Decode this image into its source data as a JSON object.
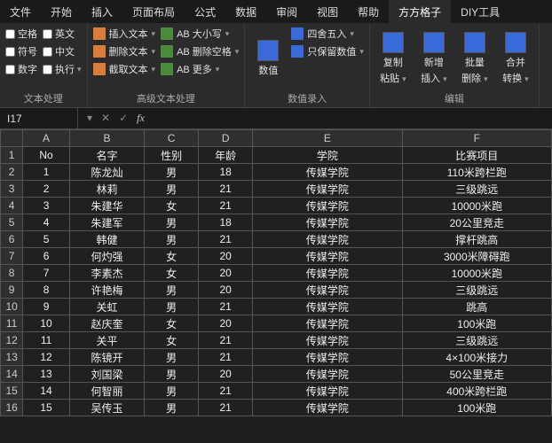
{
  "tabs": [
    "文件",
    "开始",
    "插入",
    "页面布局",
    "公式",
    "数据",
    "审阅",
    "视图",
    "帮助",
    "方方格子",
    "DIY工具"
  ],
  "active_tab": 9,
  "ribbon": {
    "text_proc": {
      "label": "文本处理",
      "checks": [
        "空格",
        "英文",
        "符号",
        "中文",
        "数字",
        "执行"
      ]
    },
    "adv_text": {
      "label": "高级文本处理",
      "col1": [
        "插入文本",
        "删除文本",
        "截取文本"
      ],
      "col2": [
        "大小写",
        "删除空格",
        "更多"
      ]
    },
    "data_entry": {
      "label": "数值录入",
      "big": "数值",
      "items": [
        "四舍五入",
        "只保留数值"
      ]
    },
    "edit": {
      "label": "编辑",
      "btns": [
        "复制粘贴",
        "新增插入",
        "批量删除",
        "合并转换"
      ]
    }
  },
  "namebox": "I17",
  "chart_data": {
    "type": "table",
    "columns": [
      "A",
      "B",
      "C",
      "D",
      "E",
      "F"
    ],
    "headers": [
      "No",
      "名字",
      "性别",
      "年龄",
      "学院",
      "比赛项目"
    ],
    "rows": [
      [
        "1",
        "陈龙灿",
        "男",
        "18",
        "传媒学院",
        "110米跨栏跑"
      ],
      [
        "2",
        "林莉",
        "男",
        "21",
        "传媒学院",
        "三级跳远"
      ],
      [
        "3",
        "朱建华",
        "女",
        "21",
        "传媒学院",
        "10000米跑"
      ],
      [
        "4",
        "朱建军",
        "男",
        "18",
        "传媒学院",
        "20公里竞走"
      ],
      [
        "5",
        "韩健",
        "男",
        "21",
        "传媒学院",
        "撑杆跳高"
      ],
      [
        "6",
        "何灼强",
        "女",
        "20",
        "传媒学院",
        "3000米障碍跑"
      ],
      [
        "7",
        "李素杰",
        "女",
        "20",
        "传媒学院",
        "10000米跑"
      ],
      [
        "8",
        "许艳梅",
        "男",
        "20",
        "传媒学院",
        "三级跳远"
      ],
      [
        "9",
        "关虹",
        "男",
        "21",
        "传媒学院",
        "跳高"
      ],
      [
        "10",
        "赵庆奎",
        "女",
        "20",
        "传媒学院",
        "100米跑"
      ],
      [
        "11",
        "关平",
        "女",
        "21",
        "传媒学院",
        "三级跳远"
      ],
      [
        "12",
        "陈镜开",
        "男",
        "21",
        "传媒学院",
        "4×100米接力"
      ],
      [
        "13",
        "刘国梁",
        "男",
        "20",
        "传媒学院",
        "50公里竞走"
      ],
      [
        "14",
        "何智丽",
        "男",
        "21",
        "传媒学院",
        "400米跨栏跑"
      ],
      [
        "15",
        "吴传玉",
        "男",
        "21",
        "传媒学院",
        "100米跑"
      ]
    ]
  }
}
